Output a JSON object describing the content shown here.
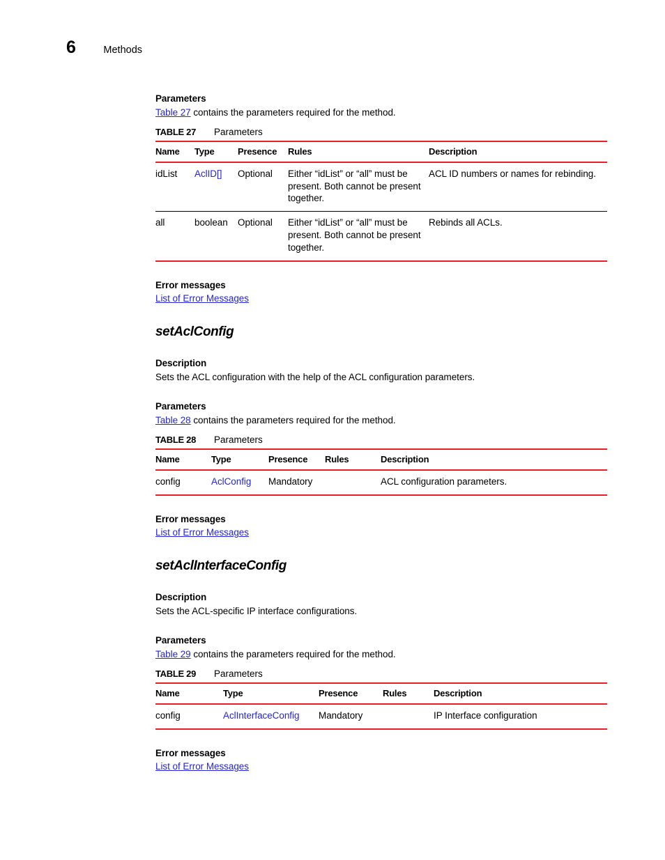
{
  "running_head": {
    "chapter_number": "6",
    "chapter_title": "Methods"
  },
  "colors": {
    "rule_red": "#ed1c24",
    "link_blue": "#2424dd",
    "text_black": "#000000"
  },
  "sections": {
    "rebind": {
      "parameters_heading": "Parameters",
      "parameters_intro_link": "Table 27",
      "parameters_intro_rest": " contains the parameters required for the method.",
      "table": {
        "caption_label": "TABLE 27",
        "caption_title": "Parameters",
        "columns": [
          "Name",
          "Type",
          "Presence",
          "Rules",
          "Description"
        ],
        "rows": [
          {
            "name": "idList",
            "type": "AclID[]",
            "type_is_link": true,
            "presence": "Optional",
            "rules": "Either “idList” or “all” must be present. Both cannot be present together.",
            "description": "ACL ID numbers  or names for rebinding."
          },
          {
            "name": "all",
            "type": "boolean",
            "type_is_link": false,
            "presence": "Optional",
            "rules": "Either “idList” or “all” must be present. Both cannot be present together.",
            "description": "Rebinds all ACLs."
          }
        ]
      },
      "error_heading": "Error messages",
      "error_link": "List of Error Messages"
    },
    "set_acl_config": {
      "method_name": "setAclConfig",
      "description_heading": "Description",
      "description_text": "Sets the ACL configuration with the help of the ACL configuration parameters.",
      "parameters_heading": "Parameters",
      "parameters_intro_link": "Table 28",
      "parameters_intro_rest": " contains the parameters required for the method.",
      "table": {
        "caption_label": "TABLE 28",
        "caption_title": "Parameters",
        "columns": [
          "Name",
          "Type",
          "Presence",
          "Rules",
          "Description"
        ],
        "rows": [
          {
            "name": "config",
            "type": "AclConfig",
            "type_is_link": true,
            "presence": "Mandatory",
            "rules": "",
            "description": "ACL configuration parameters."
          }
        ]
      },
      "error_heading": "Error messages",
      "error_link": "List of Error Messages"
    },
    "set_acl_interface_config": {
      "method_name": "setAclInterfaceConfig",
      "description_heading": "Description",
      "description_text": "Sets the ACL-specific IP interface configurations.",
      "parameters_heading": "Parameters",
      "parameters_intro_link": "Table 29",
      "parameters_intro_rest": " contains the parameters required for the method.",
      "table": {
        "caption_label": "TABLE 29",
        "caption_title": "Parameters",
        "columns": [
          "Name",
          "Type",
          "Presence",
          "Rules",
          "Description"
        ],
        "rows": [
          {
            "name": "config",
            "type": "AclInterfaceConfig",
            "type_is_link": true,
            "presence": "Mandatory",
            "rules": "",
            "description": "IP Interface configuration"
          }
        ]
      },
      "error_heading": "Error messages",
      "error_link": "List of Error Messages"
    }
  }
}
